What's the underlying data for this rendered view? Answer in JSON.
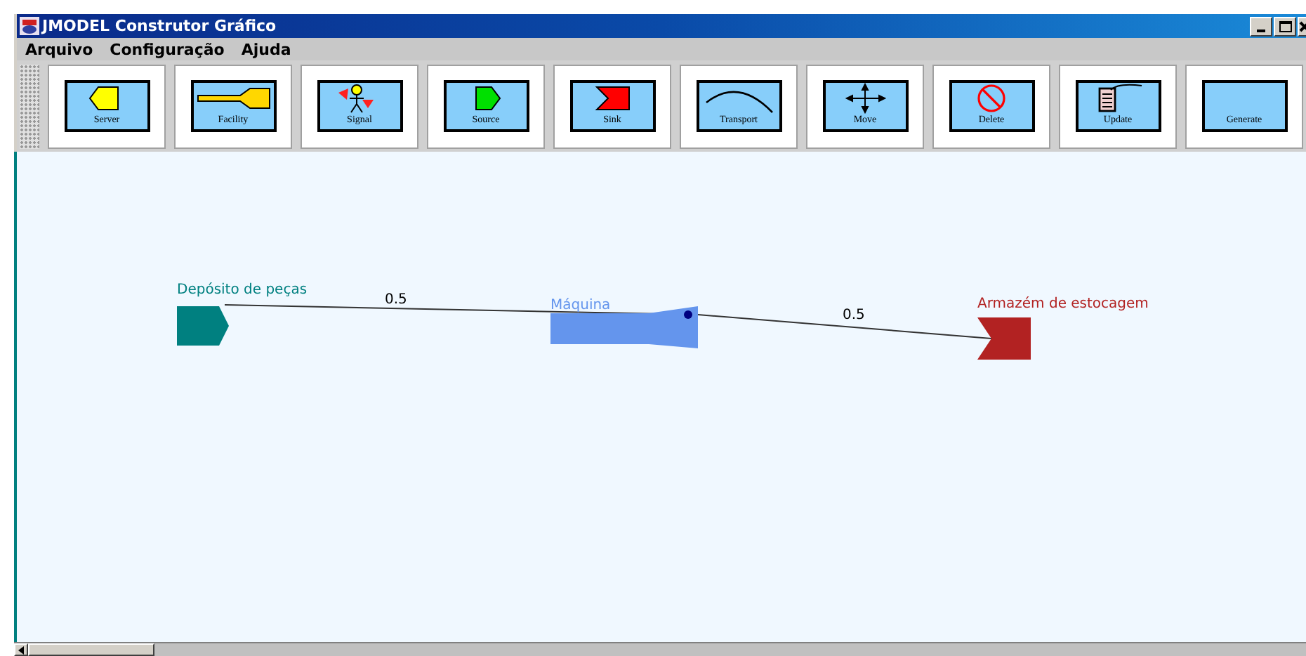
{
  "window": {
    "title": "JMODEL Construtor Gráfico"
  },
  "menu": [
    "Arquivo",
    "Configuração",
    "Ajuda"
  ],
  "toolbar": [
    {
      "label": "Server",
      "kind": "server"
    },
    {
      "label": "Facility",
      "kind": "facility"
    },
    {
      "label": "Signal",
      "kind": "signal"
    },
    {
      "label": "Source",
      "kind": "source"
    },
    {
      "label": "Sink",
      "kind": "sink"
    },
    {
      "label": "Transport",
      "kind": "transport"
    },
    {
      "label": "Move",
      "kind": "move"
    },
    {
      "label": "Delete",
      "kind": "delete"
    },
    {
      "label": "Update",
      "kind": "update"
    },
    {
      "label": "Generate",
      "kind": "generate"
    }
  ],
  "nodes": [
    {
      "label": "Depósito de peças",
      "kind": "source",
      "color": "#008080"
    },
    {
      "label": "Máquina",
      "kind": "facility",
      "color": "#6495ed"
    },
    {
      "label": "Armazém de estocagem",
      "kind": "sink",
      "color": "#b22222"
    }
  ],
  "edges": [
    {
      "label": "0.5"
    },
    {
      "label": "0.5"
    }
  ]
}
